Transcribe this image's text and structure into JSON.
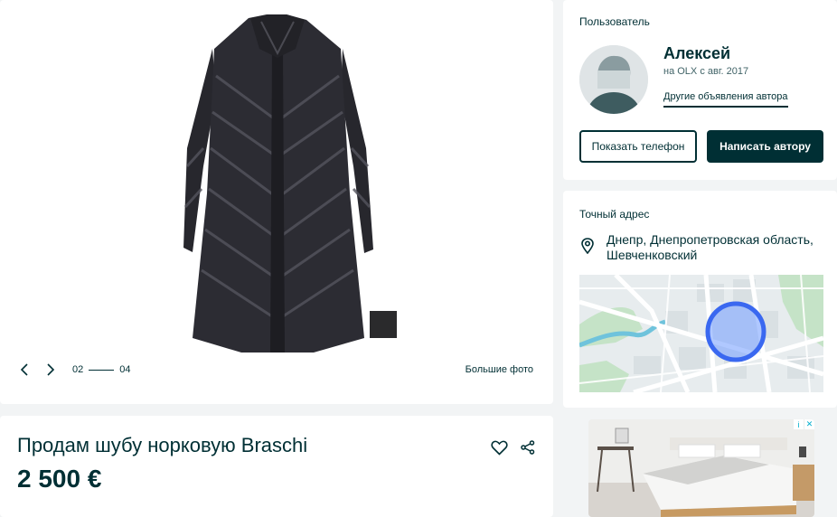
{
  "gallery": {
    "current": "02",
    "total": "04",
    "big_photos_label": "Большие фото"
  },
  "listing": {
    "title": "Продам шубу норковую Braschi",
    "price": "2 500 €"
  },
  "user": {
    "section_label": "Пользователь",
    "name": "Алексей",
    "since": "на OLX с авг. 2017",
    "other_ads_label": "Другие объявления автора",
    "show_phone_label": "Показать телефон",
    "write_author_label": "Написать автору"
  },
  "address": {
    "section_label": "Точный адрес",
    "text": "Днепр, Днепропетровская область, Шевченковский"
  },
  "icons": {
    "prev": "chevron-left-icon",
    "next": "chevron-right-icon",
    "favorite": "heart-icon",
    "share": "share-icon",
    "location": "location-pin-icon"
  },
  "colors": {
    "brand_dark": "#002f34",
    "map_circle": "#3a77ff",
    "page_bg": "#f2f4f5"
  }
}
